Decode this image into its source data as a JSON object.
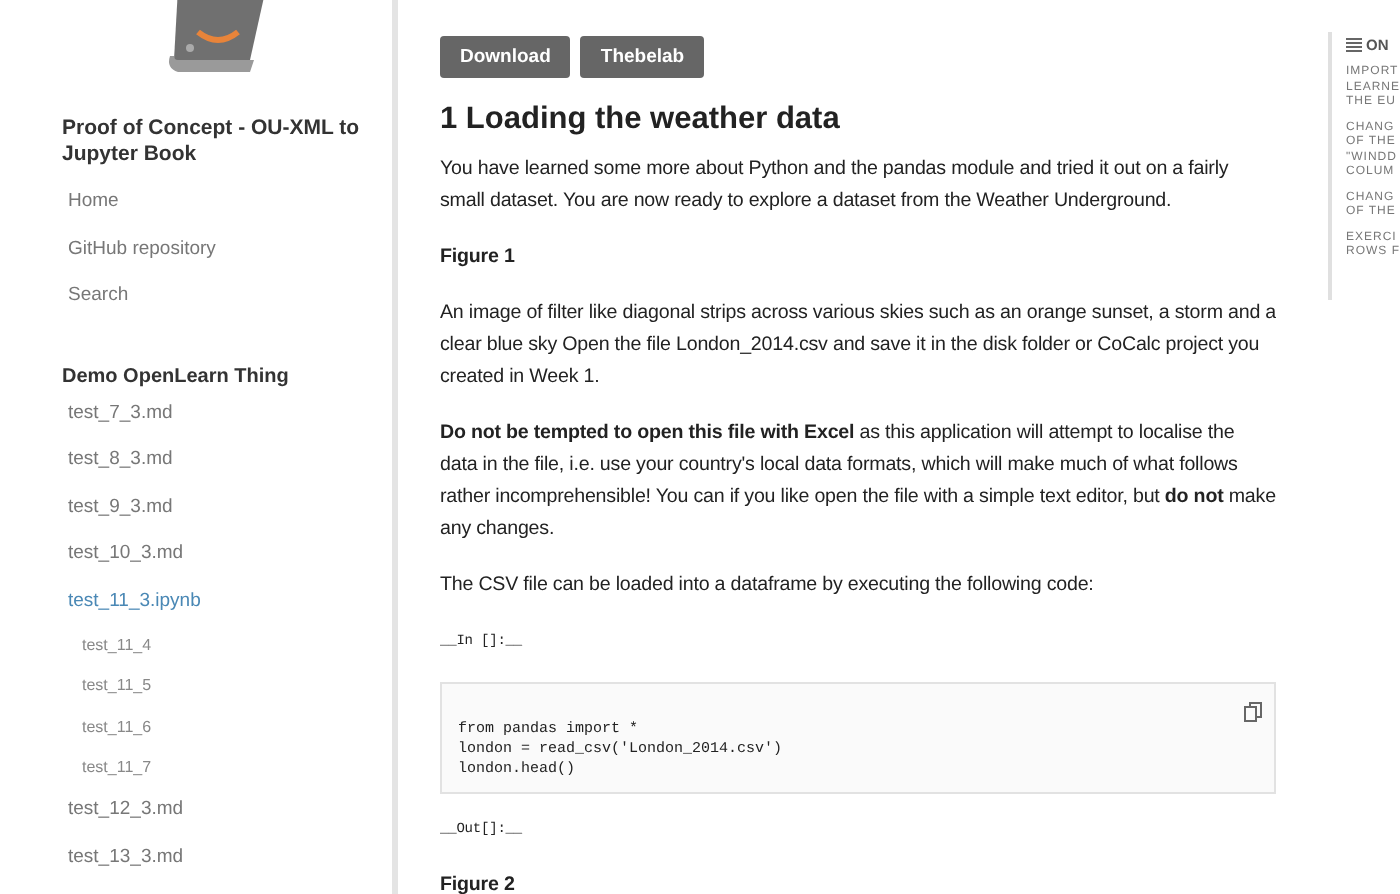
{
  "sidebar": {
    "title": "Proof of Concept - OU-XML to Jupyter Book",
    "links": [
      {
        "label": "Home"
      },
      {
        "label": "GitHub repository"
      },
      {
        "label": "Search"
      }
    ],
    "section": "Demo OpenLearn Thing",
    "items": [
      {
        "label": "test_7_3.md",
        "selected": false
      },
      {
        "label": "test_8_3.md",
        "selected": false
      },
      {
        "label": "test_9_3.md",
        "selected": false
      },
      {
        "label": "test_10_3.md",
        "selected": false
      },
      {
        "label": "test_11_3.ipynb",
        "selected": true,
        "children": [
          {
            "label": "test_11_4",
            "selected": false
          },
          {
            "label": "test_11_5",
            "selected": false
          },
          {
            "label": "test_11_6",
            "selected": false
          },
          {
            "label": "test_11_7",
            "selected": false
          }
        ]
      },
      {
        "label": "test_12_3.md",
        "selected": false
      },
      {
        "label": "test_13_3.md",
        "selected": false
      }
    ]
  },
  "toolbar": {
    "buttons": [
      "Download",
      "Thebelab"
    ]
  },
  "content": {
    "heading": "1 Loading the weather data",
    "blocks": [
      {
        "kind": "para",
        "text": "You have learned some more about Python and the pandas module and tried it out on a fairly small dataset. You are now ready to explore a dataset from the Weather Underground."
      },
      {
        "kind": "caption",
        "text": "Figure 1"
      },
      {
        "kind": "para",
        "text": "An image of filter like diagonal strips across various skies such as an orange sunset, a storm and a clear blue sky Open the file London_2014.csv and save it in the disk folder or CoCalc project you created in Week 1."
      },
      {
        "kind": "para",
        "text": "**Do not be tempted to open this file with Excel** as this application will attempt to localise the data in the file, i.e. use your country's local data formats, which will make much of what follows rather incomprehensible! You can if you like open the file with a simple text editor, but **do not** make any changes."
      },
      {
        "kind": "para",
        "text": "The CSV file can be loaded into a dataframe by executing the following code:"
      },
      {
        "kind": "prompt",
        "text": "__In []:__"
      },
      {
        "kind": "code",
        "text": "from pandas import *\nlondon = read_csv('London_2014.csv')\nlondon.head()"
      },
      {
        "kind": "prompt",
        "text": "__Out[]:__"
      },
      {
        "kind": "caption",
        "text": "Figure 2"
      }
    ]
  },
  "toc": {
    "title": "ON",
    "entries": [
      "IMPORT\nLEARNE\nTHE EU",
      "CHANG\nOF THE\n\"WINDD\nCOLUM",
      "CHANG\nOF THE",
      "EXERCI\nROWS F"
    ]
  }
}
